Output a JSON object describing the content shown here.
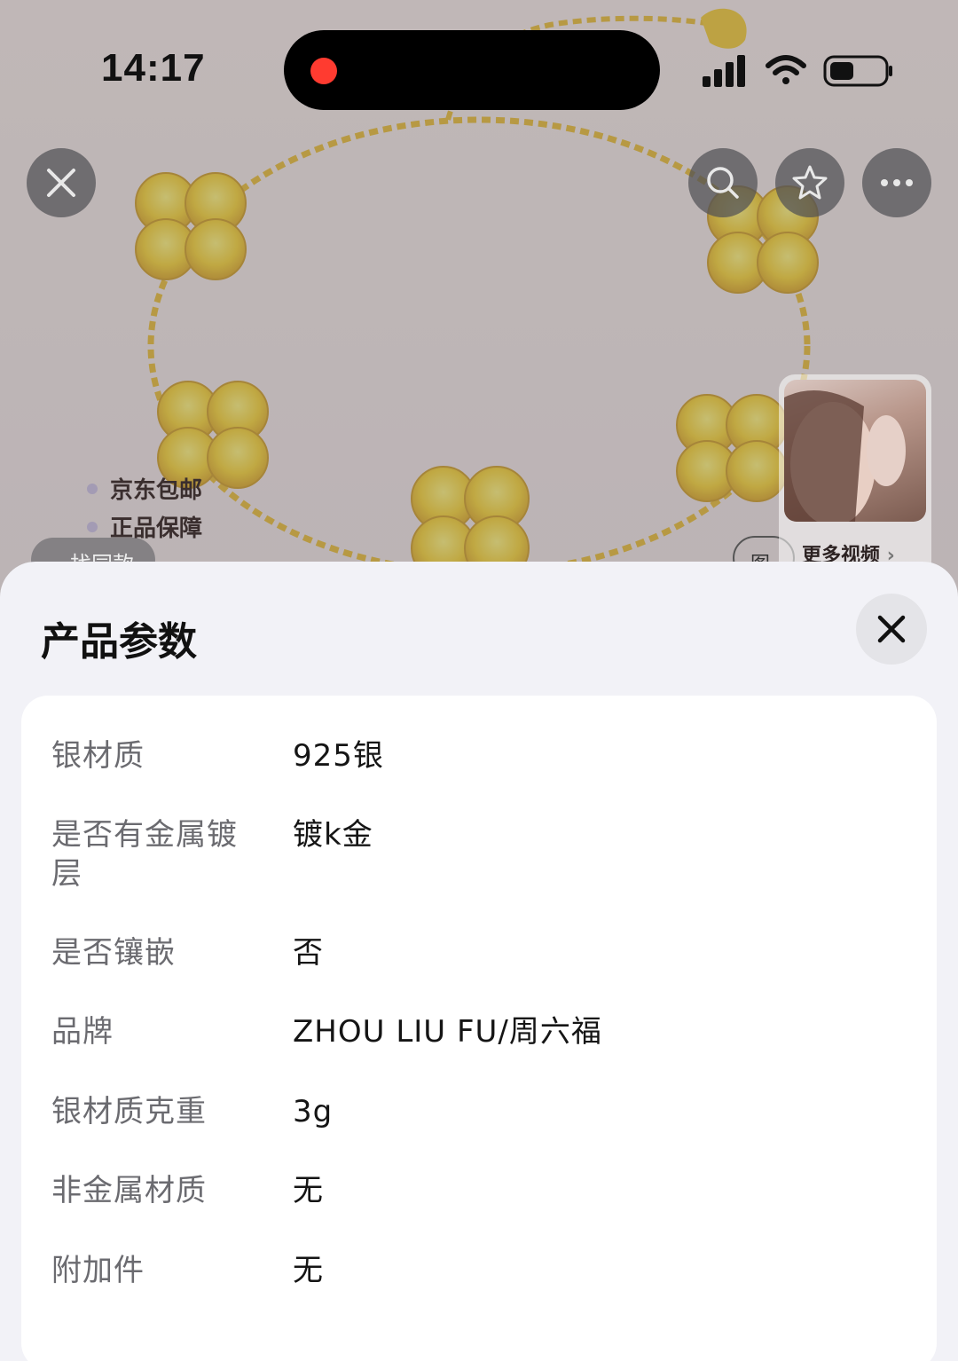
{
  "status_bar": {
    "time": "14:17"
  },
  "top_actions": {
    "close_icon": "close-icon",
    "search_icon": "search-icon",
    "favorite_icon": "star-icon",
    "more_icon": "more-dots-icon"
  },
  "promos": [
    {
      "label": "京东包邮"
    },
    {
      "label": "正品保障"
    }
  ],
  "similar_chip": {
    "label": "找同款"
  },
  "image_chip": {
    "label": "图"
  },
  "video_card": {
    "label": "更多视频"
  },
  "sheet": {
    "title": "产品参数",
    "close_icon": "close-icon",
    "params": [
      {
        "label": "银材质",
        "value": "925银"
      },
      {
        "label": "是否有金属镀层",
        "value": "镀k金"
      },
      {
        "label": "是否镶嵌",
        "value": "否"
      },
      {
        "label": "品牌",
        "value": "ZHOU LIU FU/周六福"
      },
      {
        "label": "银材质克重",
        "value": "3g"
      },
      {
        "label": "非金属材质",
        "value": "无"
      },
      {
        "label": "附加件",
        "value": "无"
      }
    ]
  },
  "colors": {
    "record_dot": "#ff3b30",
    "gold": "#f2c318",
    "sheet_bg": "#f2f2f7",
    "card_bg": "#ffffff"
  }
}
